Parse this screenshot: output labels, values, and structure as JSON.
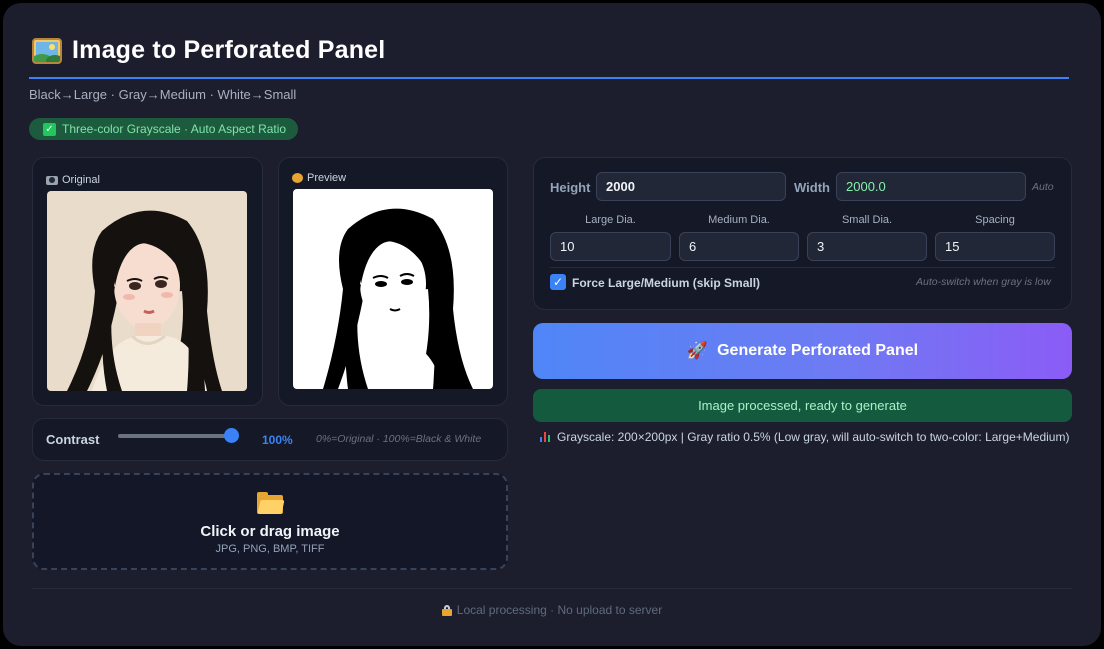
{
  "header": {
    "title": "Image to Perforated Panel",
    "subtitle": "Black→Large · Gray→Medium · White→Small",
    "badge": "Three-color Grayscale · Auto Aspect Ratio"
  },
  "preview_panels": {
    "original_label": "Original",
    "preview_label": "Preview"
  },
  "contrast": {
    "label": "Contrast",
    "value": "100%",
    "level": 1.0,
    "hint": "0%=Original · 100%=Black & White"
  },
  "upload": {
    "title": "Click or drag image",
    "formats": "JPG, PNG, BMP, TIFF"
  },
  "params": {
    "height_label": "Height",
    "height_value": "2000",
    "width_label": "Width",
    "width_value": "2000.0",
    "auto_label": "Auto",
    "large_label": "Large Dia.",
    "large_value": "10",
    "medium_label": "Medium Dia.",
    "medium_value": "6",
    "small_label": "Small Dia.",
    "small_value": "3",
    "spacing_label": "Spacing",
    "spacing_value": "15",
    "force_label": "Force Large/Medium (skip Small)",
    "force_checked": true,
    "auto_switch_hint": "Auto-switch when gray is low"
  },
  "actions": {
    "generate_label": "Generate Perforated Panel",
    "status": "Image processed, ready to generate",
    "info": "Grayscale: 200×200px | Gray ratio 0.5% (Low gray, will auto-switch to two-color: Large+Medium)"
  },
  "footer": {
    "text": "Local processing · No upload to server"
  },
  "colors": {
    "accent": "#3b82f6",
    "success_bg": "#135a3f",
    "background": "#1c1d2d"
  }
}
